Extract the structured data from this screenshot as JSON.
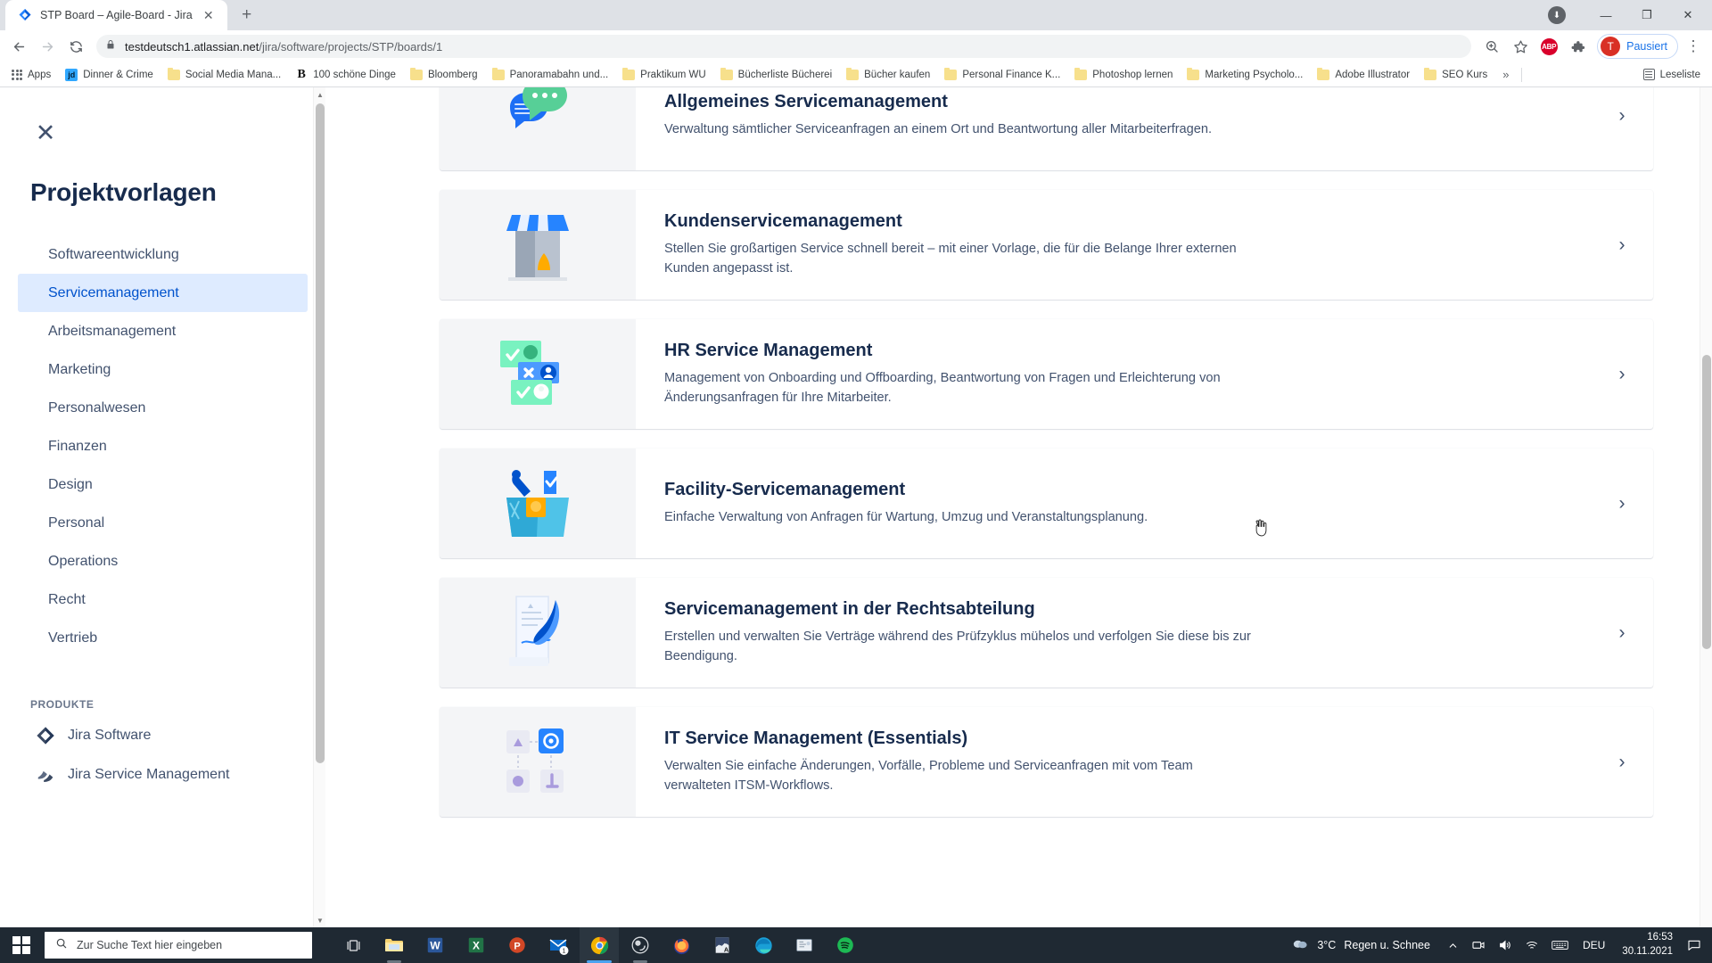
{
  "browser": {
    "tab": {
      "title": "STP Board – Agile-Board - Jira",
      "favicon": "jira-favicon",
      "close_label": "✕"
    },
    "new_tab_label": "+",
    "window_controls": {
      "download": "⬇",
      "minimize": "—",
      "maximize": "❐",
      "close": "✕"
    },
    "nav": {
      "back": "←",
      "forward": "→",
      "reload": "⟳"
    },
    "omnibox": {
      "lock_icon": "lock-icon",
      "url_host": "testdeutsch1.atlassian.net",
      "url_path": "/jira/software/projects/STP/boards/1",
      "zoom_icon": "🔍",
      "bookmark_star": "☆"
    },
    "extensions": {
      "adblock_label": "ABP",
      "puzzle_icon": "extensions-icon"
    },
    "profile": {
      "initial": "T",
      "label": "Pausiert"
    },
    "menu_icon": "⋮",
    "bookmarks": [
      {
        "label": "Apps",
        "icon": "apps-grid"
      },
      {
        "label": "Dinner & Crime",
        "icon": "id-badge"
      },
      {
        "label": "Social Media Mana...",
        "icon": "folder"
      },
      {
        "label": "100 schöne Dinge",
        "icon": "bloomberg-b"
      },
      {
        "label": "Bloomberg",
        "icon": "folder"
      },
      {
        "label": "Panoramabahn und...",
        "icon": "folder"
      },
      {
        "label": "Praktikum WU",
        "icon": "folder"
      },
      {
        "label": "Bücherliste Bücherei",
        "icon": "folder"
      },
      {
        "label": "Bücher kaufen",
        "icon": "folder"
      },
      {
        "label": "Personal Finance K...",
        "icon": "folder"
      },
      {
        "label": "Photoshop lernen",
        "icon": "folder"
      },
      {
        "label": "Marketing Psycholo...",
        "icon": "folder"
      },
      {
        "label": "Adobe Illustrator",
        "icon": "folder"
      },
      {
        "label": "SEO Kurs",
        "icon": "folder"
      }
    ],
    "bookmarks_overflow": "»",
    "reading_list": {
      "label": "Leseliste",
      "icon": "reading-list-icon"
    }
  },
  "panel": {
    "close_label": "✕",
    "title": "Projektvorlagen",
    "categories": [
      {
        "label": "Softwareentwicklung",
        "active": false
      },
      {
        "label": "Servicemanagement",
        "active": true
      },
      {
        "label": "Arbeitsmanagement",
        "active": false
      },
      {
        "label": "Marketing",
        "active": false
      },
      {
        "label": "Personalwesen",
        "active": false
      },
      {
        "label": "Finanzen",
        "active": false
      },
      {
        "label": "Design",
        "active": false
      },
      {
        "label": "Personal",
        "active": false
      },
      {
        "label": "Operations",
        "active": false
      },
      {
        "label": "Recht",
        "active": false
      },
      {
        "label": "Vertrieb",
        "active": false
      }
    ],
    "products_heading": "PRODUKTE",
    "products": [
      {
        "label": "Jira Software",
        "icon": "jira-software-icon"
      },
      {
        "label": "Jira Service Management",
        "icon": "jira-service-management-icon"
      }
    ]
  },
  "templates": [
    {
      "title": "Allgemeines Servicemanagement",
      "desc": "Verwaltung sämtlicher Serviceanfragen an einem Ort und Beantwortung aller Mitarbeiterfragen.",
      "art": "speech-bubbles-art",
      "chevron": "›"
    },
    {
      "title": "Kundenservicemanagement",
      "desc": "Stellen Sie großartigen Service schnell bereit – mit einer Vorlage, die für die Belange Ihrer externen Kunden angepasst ist.",
      "art": "storefront-art",
      "chevron": "›"
    },
    {
      "title": "HR Service Management",
      "desc": "Management von Onboarding und Offboarding, Beantwortung von Fragen und Erleichterung von Änderungsanfragen für Ihre Mitarbeiter.",
      "art": "hr-cards-art",
      "chevron": "›"
    },
    {
      "title": "Facility-Servicemanagement",
      "desc": "Einfache Verwaltung von Anfragen für Wartung, Umzug und Veranstaltungsplanung.",
      "art": "toolbox-art",
      "chevron": "›"
    },
    {
      "title": "Servicemanagement in der Rechtsabteilung",
      "desc": "Erstellen und verwalten Sie Verträge während des Prüfzyklus mühelos und verfolgen Sie diese bis zur Beendigung.",
      "art": "quill-document-art",
      "chevron": "›"
    },
    {
      "title": "IT Service Management (Essentials)",
      "desc": "Verwalten Sie einfache Änderungen, Vorfälle, Probleme und Serviceanfragen mit vom Team verwalteten ITSM-Workflows.",
      "art": "itsm-nodes-art",
      "chevron": "›"
    }
  ],
  "taskbar": {
    "start_label": "start-button",
    "search_placeholder": "Zur Suche Text hier eingeben",
    "apps": [
      {
        "name": "task-view",
        "icon": "task-view-icon"
      },
      {
        "name": "file-explorer",
        "icon": "folder-icon"
      },
      {
        "name": "word",
        "icon": "word-icon",
        "label": "W"
      },
      {
        "name": "excel",
        "icon": "excel-icon",
        "label": "X"
      },
      {
        "name": "powerpoint",
        "icon": "powerpoint-icon",
        "label": "P"
      },
      {
        "name": "mail",
        "icon": "mail-icon",
        "badge": "1"
      },
      {
        "name": "chrome",
        "icon": "chrome-icon"
      },
      {
        "name": "obs",
        "icon": "obs-icon"
      },
      {
        "name": "firefox",
        "icon": "firefox-icon"
      },
      {
        "name": "photoshop",
        "icon": "photoshop-icon"
      },
      {
        "name": "edge",
        "icon": "edge-icon"
      },
      {
        "name": "notes",
        "icon": "notes-icon"
      },
      {
        "name": "spotify",
        "icon": "spotify-icon"
      }
    ],
    "tray": {
      "weather_temp": "3°C",
      "weather_desc": "Regen u. Schnee",
      "chevron": "⌃",
      "onedrive_icon": "onedrive-icon",
      "volume_icon": "volume-icon",
      "network_icon": "wifi-icon",
      "keyboard_icon": "keyboard-icon",
      "language": "DEU",
      "time": "16:53",
      "date": "30.11.2021",
      "notifications_icon": "action-center-icon"
    }
  },
  "colors": {
    "jira_blue": "#0052cc",
    "selected_bg": "#deebff",
    "text_primary": "#172b4d",
    "text_secondary": "#42526e",
    "card_art_bg": "#f4f5f7",
    "taskbar": "#1f2933",
    "chrome_tabstrip": "#dee1e6"
  }
}
